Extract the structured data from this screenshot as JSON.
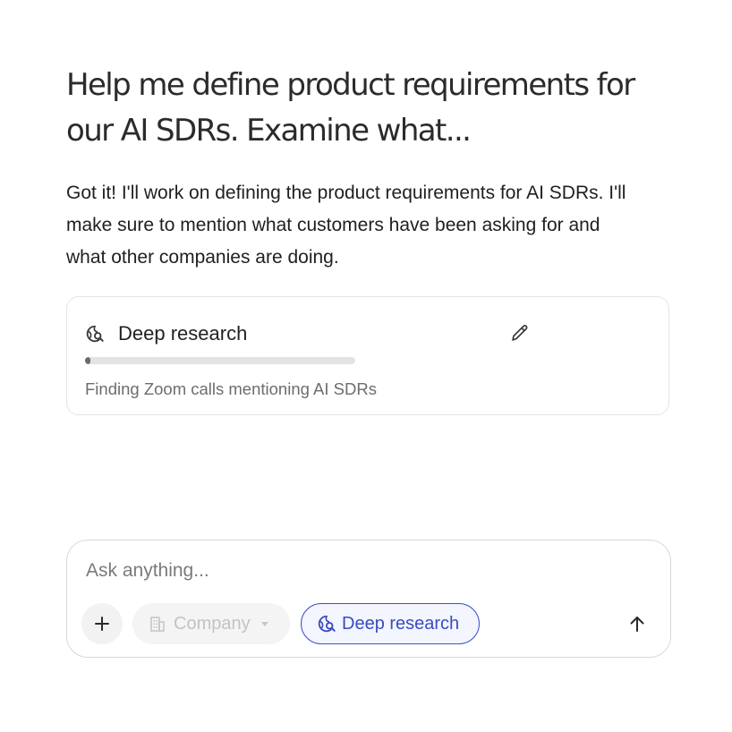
{
  "conversation": {
    "prompt": "Help me define product requirements for our AI SDRs. Examine what...",
    "reply": "Got it! I'll work on defining the product requirements for AI SDRs. I'll make sure to mention what customers have been asking for and what other companies are doing."
  },
  "research_card": {
    "title": "Deep research",
    "icon": "deep-research-icon",
    "edit_icon": "pencil-icon",
    "progress": 0.02,
    "status": "Finding Zoom calls mentioning AI SDRs"
  },
  "composer": {
    "placeholder": "Ask anything...",
    "value": "",
    "add_icon": "plus-icon",
    "company_selector": {
      "label": "Company",
      "icon": "building-icon",
      "disabled": true
    },
    "deep_research_toggle": {
      "label": "Deep research",
      "active": true,
      "color": "#3a4bbf"
    },
    "send_icon": "arrow-up-icon"
  }
}
